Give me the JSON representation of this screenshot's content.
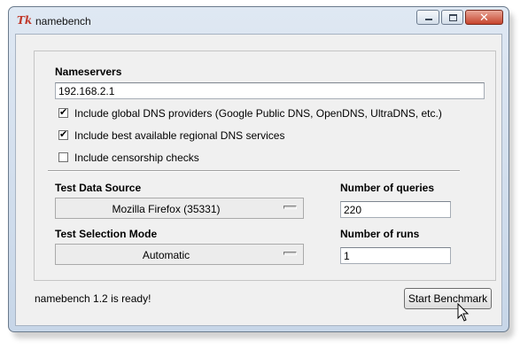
{
  "window": {
    "title": "namebench",
    "icon": "tk-feather-icon",
    "close_glyph": "✕"
  },
  "nameservers": {
    "label": "Nameservers",
    "value": "192.168.2.1"
  },
  "checkboxes": [
    {
      "label": "Include global DNS providers (Google Public DNS, OpenDNS, UltraDNS, etc.)",
      "checked": true
    },
    {
      "label": "Include best available regional DNS services",
      "checked": true
    },
    {
      "label": "Include censorship checks",
      "checked": false
    }
  ],
  "check_mark": "✔",
  "test_data_source": {
    "label": "Test Data Source",
    "value": "Mozilla Firefox (35331)"
  },
  "test_selection_mode": {
    "label": "Test Selection Mode",
    "value": "Automatic"
  },
  "number_of_queries": {
    "label": "Number of queries",
    "value": "220"
  },
  "number_of_runs": {
    "label": "Number of runs",
    "value": "1"
  },
  "status": {
    "text": "namebench 1.2 is ready!"
  },
  "start_button": {
    "label": "Start Benchmark"
  }
}
